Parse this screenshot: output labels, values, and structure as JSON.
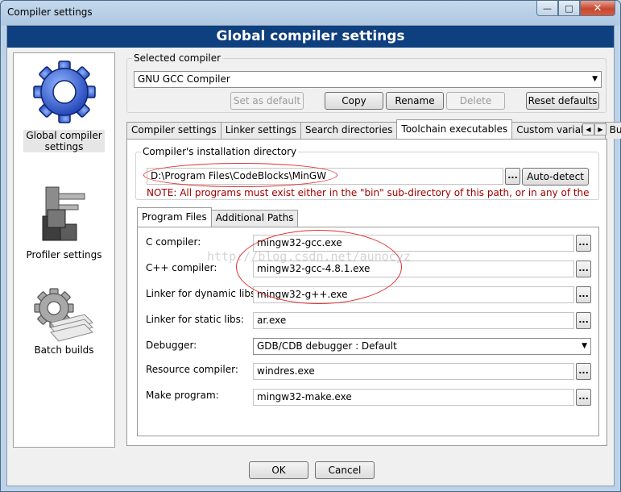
{
  "window": {
    "title": "Compiler settings",
    "minimize_glyph": "—",
    "maximize_glyph": "□",
    "close_glyph": "✕"
  },
  "banner": {
    "title": "Global compiler settings"
  },
  "sidebar": {
    "items": [
      {
        "label_line1": "Global compiler",
        "label_line2": "settings",
        "icon": "gear-icon",
        "selected": true
      },
      {
        "label_line1": "Profiler settings",
        "label_line2": "",
        "icon": "profiler-icon",
        "selected": false
      },
      {
        "label_line1": "Batch builds",
        "label_line2": "",
        "icon": "batch-builds-icon",
        "selected": false
      }
    ]
  },
  "selected_compiler": {
    "group_label": "Selected compiler",
    "value": "GNU GCC Compiler"
  },
  "compiler_buttons": {
    "set_default": "Set as default",
    "copy": "Copy",
    "rename": "Rename",
    "delete": "Delete",
    "reset_defaults": "Reset defaults"
  },
  "tabs": [
    {
      "label": "Compiler settings"
    },
    {
      "label": "Linker settings"
    },
    {
      "label": "Search directories"
    },
    {
      "label": "Toolchain executables"
    },
    {
      "label": "Custom variables"
    },
    {
      "label": "Bui"
    }
  ],
  "tab_scroll": {
    "left": "◀",
    "right": "▶"
  },
  "install_dir": {
    "group_label": "Compiler's installation directory",
    "value": "D:\\Program Files\\CodeBlocks\\MinGW",
    "browse": "...",
    "auto_detect": "Auto-detect",
    "note": "NOTE: All programs must exist either in the \"bin\" sub-directory of this path, or in any of the"
  },
  "inner_tabs": [
    {
      "label": "Program Files"
    },
    {
      "label": "Additional Paths"
    }
  ],
  "programs": {
    "browse": "...",
    "c_compiler": {
      "label": "C compiler:",
      "value": "mingw32-gcc.exe"
    },
    "cpp_compiler": {
      "label": "C++ compiler:",
      "value": "mingw32-gcc-4.8.1.exe"
    },
    "linker_dynamic": {
      "label": "Linker for dynamic libs:",
      "value": "mingw32-g++.exe"
    },
    "linker_static": {
      "label": "Linker for static libs:",
      "value": "ar.exe"
    },
    "debugger": {
      "label": "Debugger:",
      "value": "GDB/CDB debugger : Default"
    },
    "resource_compiler": {
      "label": "Resource compiler:",
      "value": "windres.exe"
    },
    "make_program": {
      "label": "Make program:",
      "value": "mingw32-make.exe"
    }
  },
  "watermark": "http://blog.csdn.net/aunocyz",
  "dialog_buttons": {
    "ok": "OK",
    "cancel": "Cancel"
  },
  "colors": {
    "banner_bg": "#0e3f7e",
    "note_text": "#a00000",
    "annotation": "#e03030"
  }
}
